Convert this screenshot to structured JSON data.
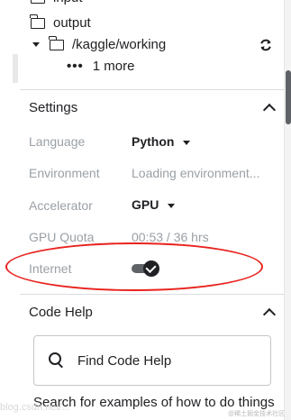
{
  "file_tree": {
    "partial_item": "input",
    "output_folder": "output",
    "working_folder": "/kaggle/working",
    "more_items": "1 more"
  },
  "settings": {
    "title": "Settings",
    "language": {
      "label": "Language",
      "value": "Python"
    },
    "environment": {
      "label": "Environment",
      "value": "Loading environment..."
    },
    "accelerator": {
      "label": "Accelerator",
      "value": "GPU"
    },
    "gpu_quota": {
      "label": "GPU Quota",
      "value": "00:53 / 36 hrs"
    },
    "internet": {
      "label": "Internet",
      "enabled": true
    }
  },
  "code_help": {
    "title": "Code Help",
    "search_label": "Find Code Help",
    "description": "Search for examples of how to do things"
  },
  "watermark": {
    "left": "blog.csdn.net/...",
    "right": "@稀土掘金技术社区"
  },
  "annotation_color": "#e8231f"
}
